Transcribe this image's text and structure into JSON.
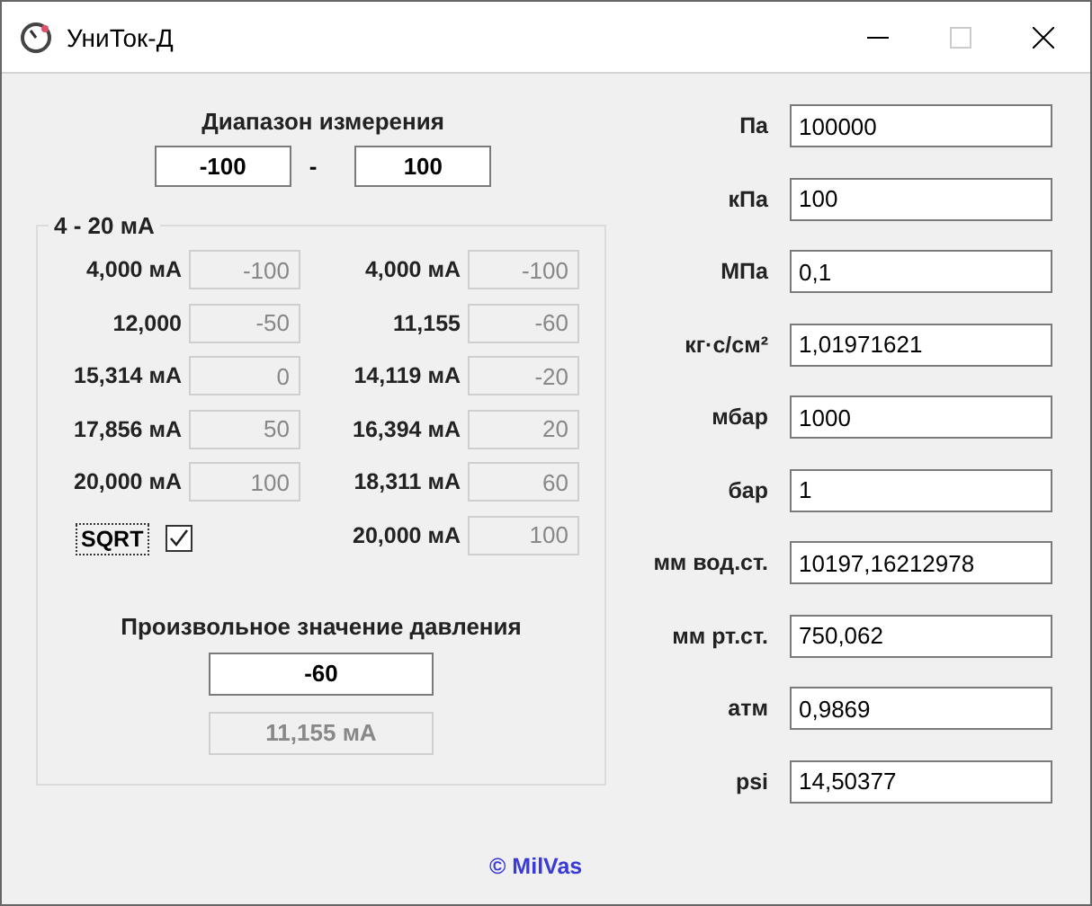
{
  "window": {
    "title": "УниТок-Д"
  },
  "range": {
    "label": "Диапазон измерения",
    "from": "-100",
    "separator": "-",
    "to": "100"
  },
  "group": {
    "title": "4 - 20 мА",
    "left": [
      {
        "label": "4,000 мА",
        "value": "-100"
      },
      {
        "label": "12,000",
        "value": "-50"
      },
      {
        "label": "15,314 мА",
        "value": "0"
      },
      {
        "label": "17,856 мА",
        "value": "50"
      },
      {
        "label": "20,000 мА",
        "value": "100"
      }
    ],
    "sqrt": {
      "label": "SQRT",
      "checked": true
    },
    "right": [
      {
        "label": "4,000 мА",
        "value": "-100"
      },
      {
        "label": "11,155",
        "value": "-60"
      },
      {
        "label": "14,119 мА",
        "value": "-20"
      },
      {
        "label": "16,394 мА",
        "value": "20"
      },
      {
        "label": "18,311 мА",
        "value": "60"
      },
      {
        "label": "20,000 мА",
        "value": "100"
      }
    ],
    "arbitrary": {
      "label": "Произвольное значение давления",
      "value": "-60",
      "result": "11,155 мА"
    }
  },
  "units": [
    {
      "label": "Па",
      "value": "100000"
    },
    {
      "label": "кПа",
      "value": "100"
    },
    {
      "label": "МПа",
      "value": "0,1"
    },
    {
      "label": "кг·с/см²",
      "value": "1,01971621"
    },
    {
      "label": "мбар",
      "value": "1000"
    },
    {
      "label": "бар",
      "value": "1"
    },
    {
      "label": "мм вод.ст.",
      "value": "10197,16212978"
    },
    {
      "label": "мм рт.ст.",
      "value": "750,062"
    },
    {
      "label": "атм",
      "value": "0,9869"
    },
    {
      "label": "psi",
      "value": "14,50377"
    }
  ],
  "footer": "© MilVas"
}
